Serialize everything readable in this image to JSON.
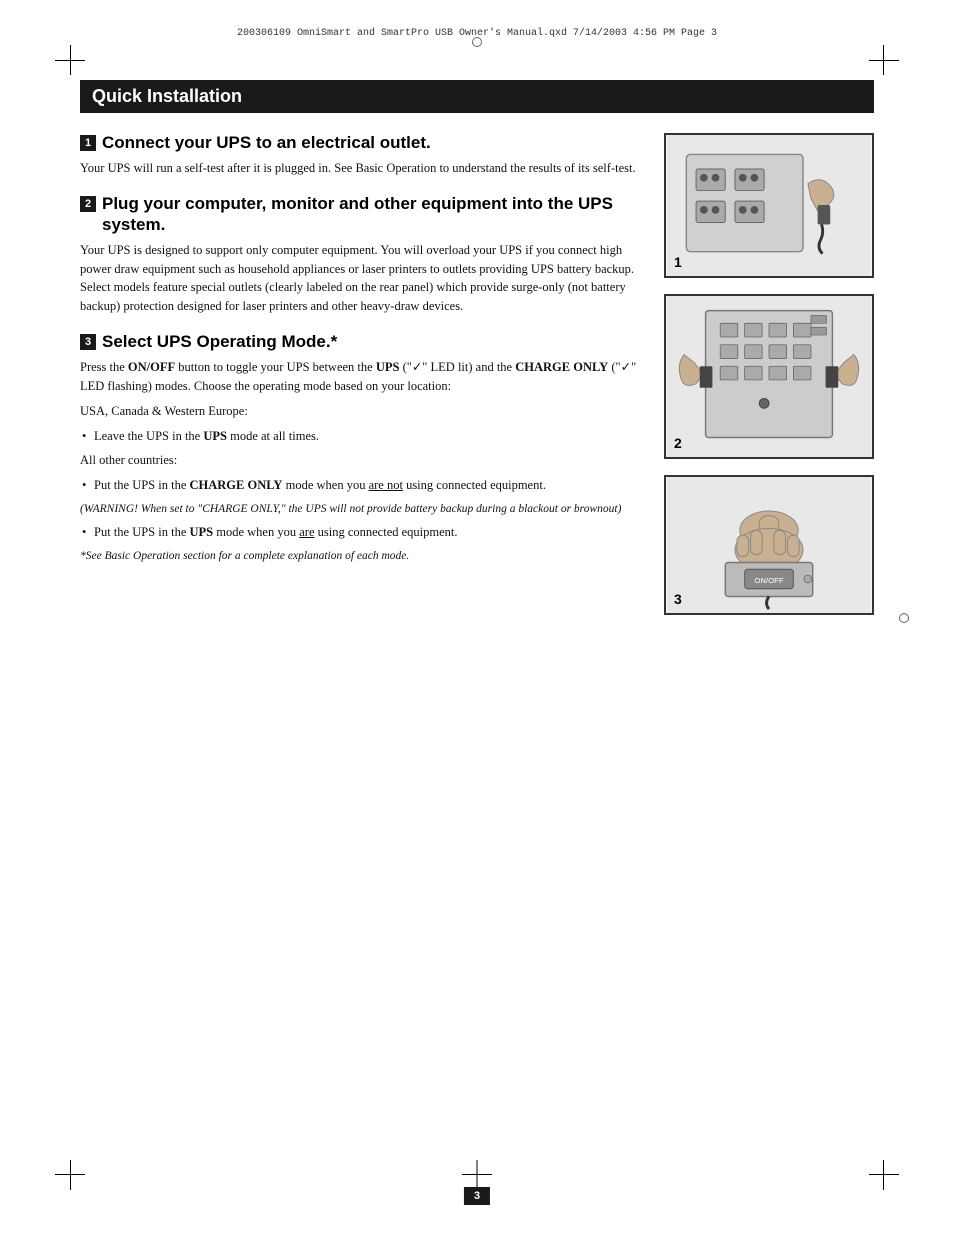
{
  "metadata": {
    "line": "200306109  OmniSmart and SmartPro USB Owner's Manual.qxd   7/14/2003   4:56 PM   Page 3"
  },
  "title": "Quick Installation",
  "steps": [
    {
      "number": "1",
      "title": "Connect your UPS to an electrical outlet.",
      "body": "Your UPS will run a self-test after it is plugged in. See Basic Operation to understand the results of its self-test."
    },
    {
      "number": "2",
      "title": "Plug your computer, monitor and other equipment into the UPS system.",
      "body": "Your UPS is designed to support only computer equipment. You will overload your UPS if you connect high power draw equipment such as household appliances or laser printers to outlets providing UPS battery backup. Select models feature special outlets (clearly labeled on the rear panel) which provide surge-only (not battery backup) protection designed for laser printers and other heavy-draw devices."
    },
    {
      "number": "3",
      "title": "Select UPS Operating Mode.*",
      "intro": "Press the ",
      "onoff_bold": "ON/OFF",
      "intro2": " button to toggle your UPS between the ",
      "ups_bold": "UPS",
      "intro3": " (“✓” LED lit) and the ",
      "charge_bold": "CHARGE ONLY",
      "intro4": " (“✓” LED flashing) modes. Choose the operating mode based on your location:",
      "regions": [
        {
          "label": "USA, Canada & Western Europe:",
          "bullets": [
            "Leave the UPS in the UPS mode at all times."
          ]
        },
        {
          "label": "All other countries:",
          "bullets": [
            "Put the UPS in the CHARGE ONLY mode when you are not using connected equipment."
          ],
          "warning": "(WARNING! When set to “CHARGE ONLY,” the UPS will not provide battery backup during a blackout or brownout)",
          "extra_bullets": [
            "Put the UPS in the UPS mode when you are using connected equipment."
          ]
        }
      ],
      "footnote": "*See Basic Operation section for a complete explanation of each mode."
    }
  ],
  "page_number": "3",
  "images": [
    {
      "label": "1",
      "alt": "UPS electrical outlet connection illustration"
    },
    {
      "label": "2",
      "alt": "UPS system with equipment connected illustration"
    },
    {
      "label": "3",
      "alt": "UPS operating mode selection illustration"
    }
  ]
}
